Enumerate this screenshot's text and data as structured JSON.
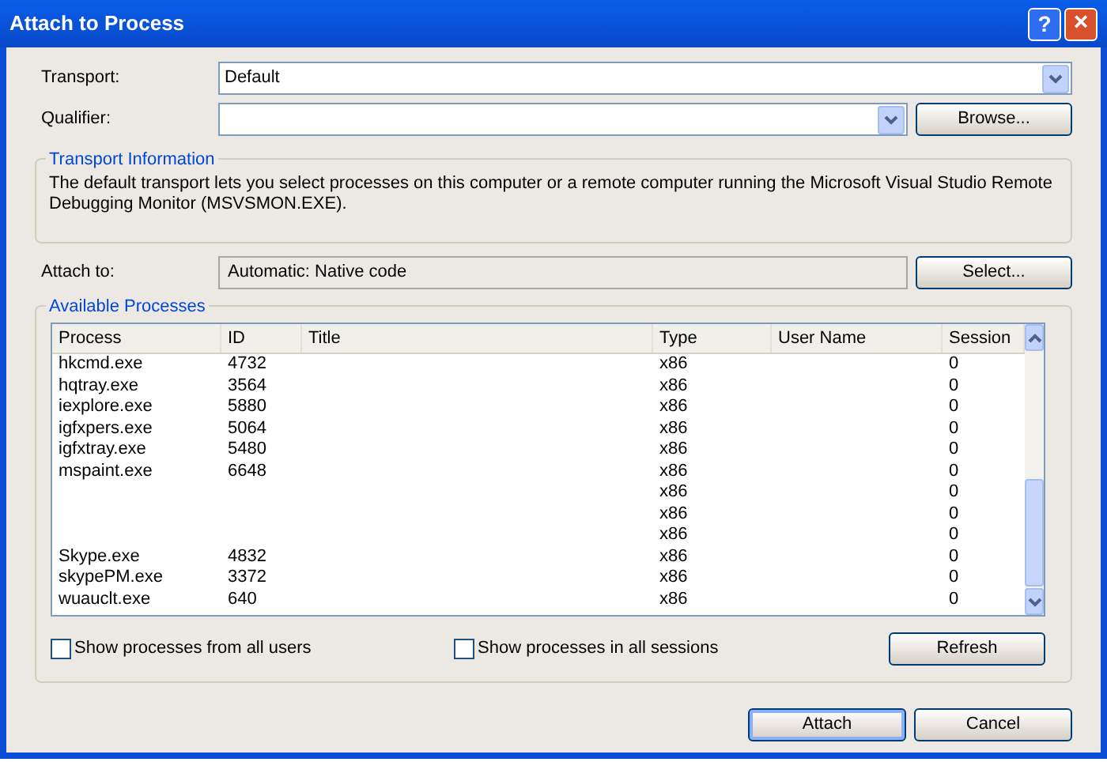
{
  "window": {
    "title": "Attach to Process",
    "help_button": "?",
    "close_button": "×"
  },
  "transport": {
    "label": "Transport:",
    "value": "Default"
  },
  "qualifier": {
    "label": "Qualifier:",
    "button": "Browse..."
  },
  "transport_information": {
    "title": "Transport Information",
    "text": "The default transport lets you select processes on this computer or a remote computer running the Microsoft Visual Studio Remote Debugging Monitor (MSVSMON.EXE)."
  },
  "attach_to": {
    "label": "Attach to:",
    "value": "Automatic: Native code",
    "button": "Select..."
  },
  "available_processes": {
    "title": "Available Processes",
    "columns": [
      "Process",
      "ID",
      "Title",
      "Type",
      "User Name",
      "Session"
    ],
    "rows": [
      {
        "process": "hkcmd.exe",
        "id": "4732",
        "type": "x86",
        "session": "0"
      },
      {
        "process": "hqtray.exe",
        "id": "3564",
        "type": "x86",
        "session": "0"
      },
      {
        "process": "iexplore.exe",
        "id": "5880",
        "type": "x86",
        "session": "0"
      },
      {
        "process": "igfxpers.exe",
        "id": "5064",
        "type": "x86",
        "session": "0"
      },
      {
        "process": "igfxtray.exe",
        "id": "5480",
        "type": "x86",
        "session": "0"
      },
      {
        "process": "mspaint.exe",
        "id": "6648",
        "type": "x86",
        "session": "0"
      },
      {
        "type": "x86",
        "session": "0"
      },
      {
        "type": "x86",
        "session": "0"
      },
      {
        "type": "x86",
        "session": "0"
      },
      {
        "process": "Skype.exe",
        "id": "4832",
        "type": "x86",
        "session": "0"
      },
      {
        "process": "skypePM.exe",
        "id": "3372",
        "type": "x86",
        "session": "0"
      },
      {
        "process": "wuauclt.exe",
        "id": "640",
        "type": "x86",
        "session": "0"
      }
    ],
    "options": [
      {
        "label": "Show processes from all users",
        "checked": false
      },
      {
        "label": "Show processes in all sessions",
        "checked": false
      }
    ],
    "refresh_button": "Refresh"
  },
  "buttons": [
    {
      "label": "Attach",
      "selected": true
    },
    {
      "label": "Cancel",
      "selected": false
    }
  ]
}
